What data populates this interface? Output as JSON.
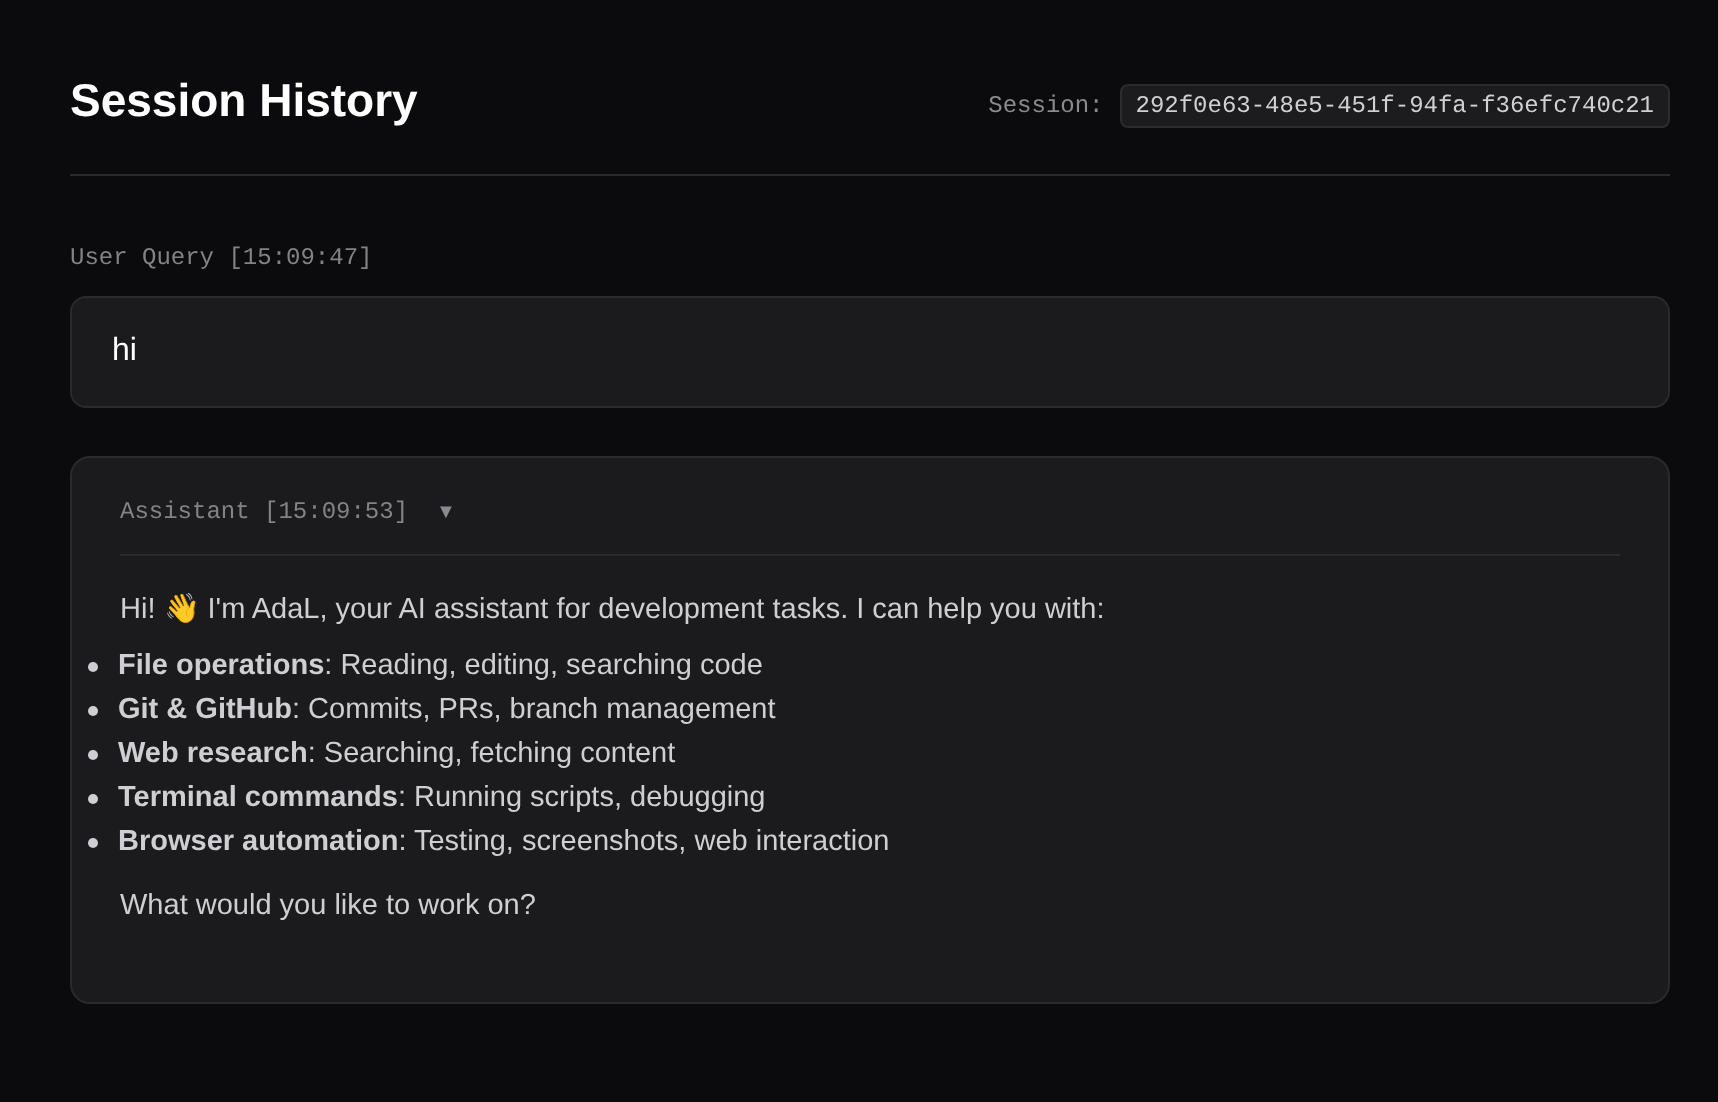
{
  "header": {
    "title": "Session History",
    "session_label": "Session:",
    "session_id": "292f0e63-48e5-451f-94fa-f36efc740c21"
  },
  "messages": [
    {
      "kind": "user",
      "label": "User Query [15:09:47]",
      "text": "hi"
    },
    {
      "kind": "assistant",
      "label": "Assistant [15:09:53]",
      "toggle": "▼",
      "expanded": true,
      "intro": "Hi! 👋 I'm AdaL, your AI assistant for development tasks. I can help you with:",
      "items": [
        {
          "title": "File operations",
          "text": ": Reading, editing, searching code"
        },
        {
          "title": "Git & GitHub",
          "text": ": Commits, PRs, branch management"
        },
        {
          "title": "Web research",
          "text": ": Searching, fetching content"
        },
        {
          "title": "Terminal commands",
          "text": ": Running scripts, debugging"
        },
        {
          "title": "Browser automation",
          "text": ": Testing, screenshots, web interaction"
        }
      ],
      "outro": "What would you like to work on?"
    }
  ]
}
